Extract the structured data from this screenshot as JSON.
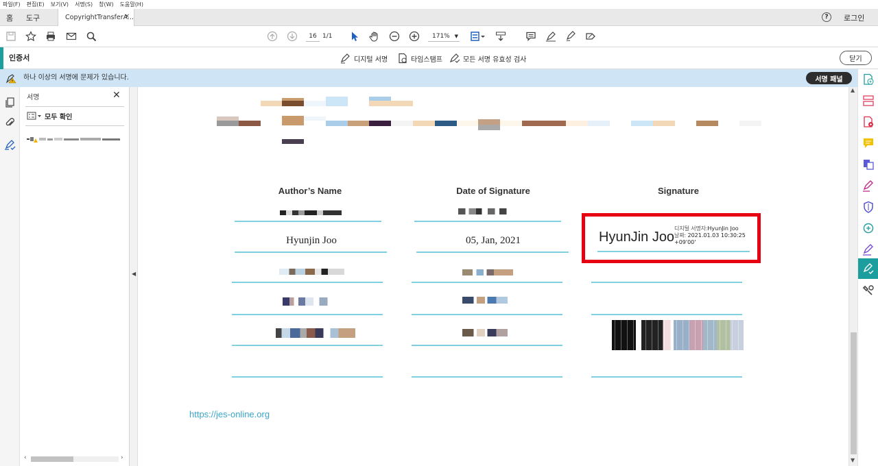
{
  "menu": [
    "파일(F)",
    "편집(E)",
    "보기(V)",
    "서명(S)",
    "창(W)",
    "도움말(H)"
  ],
  "tabs": {
    "home": "홈",
    "tools": "도구",
    "document": "CopyrightTransferA...",
    "close": "×"
  },
  "header": {
    "help": "?",
    "login": "로그인"
  },
  "toolbar": {
    "page_current": "16",
    "page_total": "1/1",
    "zoom": "171%"
  },
  "cert_bar": {
    "title": "인증서",
    "digital_sign": "디지털 서명",
    "timestamp": "타임스탬프",
    "validate_all": "모든 서명 유효성 검사",
    "close": "닫기"
  },
  "warning": {
    "text": "하나 이상의 서명에 문제가 있습니다.",
    "panel_button": "서명 패널"
  },
  "sig_panel": {
    "title": "서명",
    "close": "✕",
    "verify_all": "모두 확인"
  },
  "document": {
    "columns": [
      "Author’s Name",
      "Date of Signature",
      "Signature"
    ],
    "author": "Hyunjin Joo",
    "date": "05, Jan, 2021",
    "signature": {
      "name": "HyunJin Joo",
      "label_signed_by": "디지털 서명자:",
      "signed_by": "HyunJin Joo",
      "label_date": "날짜:",
      "date": "2021.01.03 10:30:25",
      "tz": "+09'00'"
    },
    "url": "https://jes-online.org"
  },
  "colors": {
    "accent": "#1c9e9e",
    "highlight": "#e60012",
    "rule": "#7fd0e0",
    "link": "#3aa5c8",
    "warn_bg": "#cfe4f5"
  }
}
